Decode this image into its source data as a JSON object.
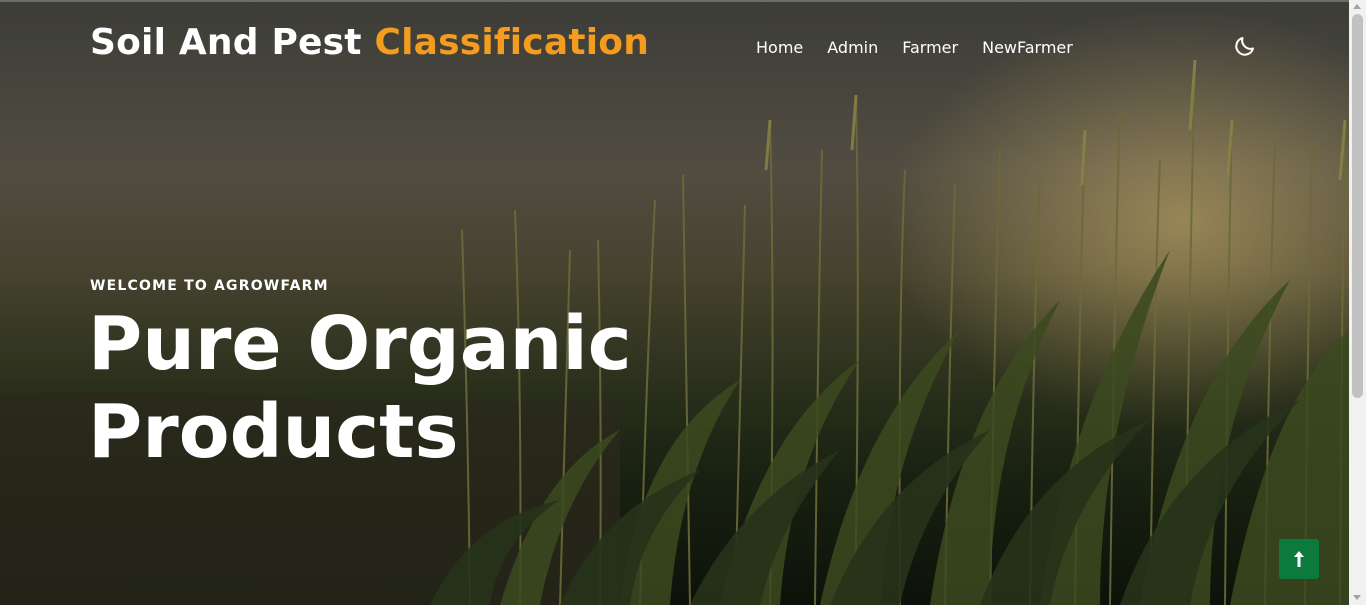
{
  "brand": {
    "part1": "Soil And Pest",
    "part2": "Classification"
  },
  "nav": {
    "items": [
      "Home",
      "Admin",
      "Farmer",
      "NewFarmer"
    ]
  },
  "header": {
    "theme_toggle_icon": "moon-icon"
  },
  "hero": {
    "subtitle": "WELCOME TO AGROWFARM",
    "title_line1": "Pure Organic",
    "title_line2": "Products",
    "background_icon": "corn-field-photo"
  },
  "back_to_top": {
    "icon": "arrow-up-icon",
    "color": "#0b7a3c"
  },
  "colors": {
    "accent": "#f39c1f",
    "text": "#ffffff",
    "button": "#0b7a3c"
  }
}
